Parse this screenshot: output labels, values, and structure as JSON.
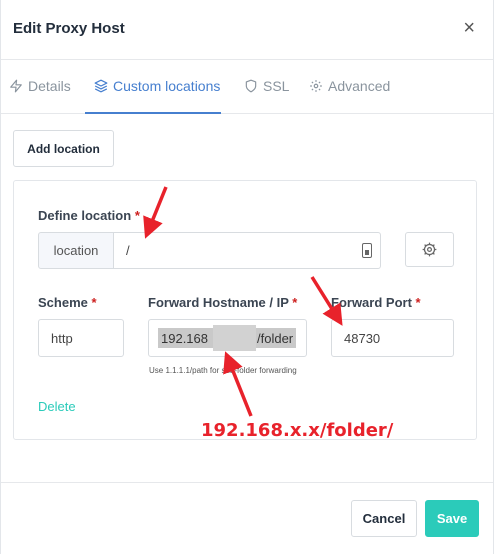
{
  "dialog": {
    "title": "Edit Proxy Host",
    "close_glyph": "×"
  },
  "tabs": [
    {
      "label": "Details",
      "icon": "zap-icon",
      "active": false
    },
    {
      "label": "Custom locations",
      "icon": "layers-icon",
      "active": true
    },
    {
      "label": "SSL",
      "icon": "shield-icon",
      "active": false
    },
    {
      "label": "Advanced",
      "icon": "gear-icon",
      "active": false
    }
  ],
  "add_location_label": "Add location",
  "location": {
    "define_label": "Define location",
    "required_mark": "*",
    "addon_text": "location",
    "path_value": "/",
    "scheme_label": "Scheme",
    "scheme_value": "http",
    "hostname_label": "Forward Hostname / IP",
    "hostname_value_start": "192.168",
    "hostname_value_end": "/folder",
    "hostname_help": "Use 1.1.1.1/path for sub-folder forwarding",
    "port_label": "Forward Port",
    "port_value": "48730",
    "delete_label": "Delete"
  },
  "annotation_text": "192.168.x.x/folder/",
  "footer": {
    "cancel_label": "Cancel",
    "save_label": "Save"
  },
  "colors": {
    "accent": "#467fcf",
    "save_button": "#2bcbba",
    "required": "#cd201f",
    "annotation": "#e8222b"
  }
}
